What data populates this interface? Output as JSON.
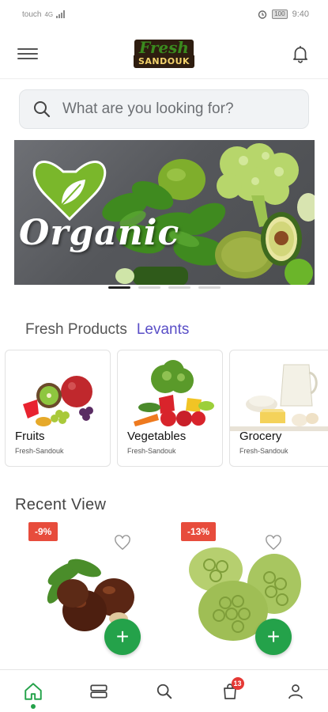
{
  "status_bar": {
    "carrier": "touch",
    "signal": "4G",
    "battery": "100",
    "time": "9:40"
  },
  "header": {
    "logo_top": "Fresh",
    "logo_bottom": "SANDOUK"
  },
  "search": {
    "placeholder": "What are you looking for?"
  },
  "banner": {
    "text": "Organic"
  },
  "category_tabs": [
    {
      "label": "Fresh Products"
    },
    {
      "label": "Levants"
    }
  ],
  "categories": [
    {
      "name": "Fruits",
      "subtitle": "Fresh-Sandouk"
    },
    {
      "name": "Vegetables",
      "subtitle": "Fresh-Sandouk"
    },
    {
      "name": "Grocery",
      "subtitle": "Fresh-Sandouk"
    }
  ],
  "recent": {
    "title": "Recent View",
    "products": [
      {
        "discount": "-9%"
      },
      {
        "discount": "-13%"
      }
    ]
  },
  "bottom_nav": {
    "cart_badge": "13",
    "items": [
      "home-icon",
      "categories-icon",
      "search-icon",
      "cart-icon",
      "profile-icon"
    ]
  },
  "colors": {
    "accent": "#24a24a",
    "discount": "#e74c3c",
    "tab_alt": "#5a4fc7",
    "badge": "#e53935"
  }
}
